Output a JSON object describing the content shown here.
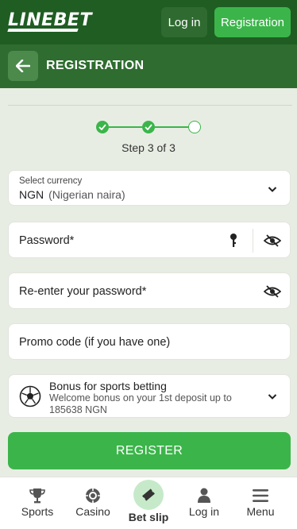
{
  "header": {
    "logo": "LINEBET",
    "login_label": "Log in",
    "registration_label": "Registration"
  },
  "titlebar": {
    "title": "REGISTRATION"
  },
  "stepper": {
    "text": "Step 3 of 3",
    "current": 3,
    "total": 3
  },
  "form": {
    "currency": {
      "label": "Select currency",
      "code": "NGN",
      "name": "(Nigerian naira)"
    },
    "password_placeholder": "Password*",
    "reenter_placeholder": "Re-enter your password*",
    "promo_placeholder": "Promo code (if you have one)",
    "bonus": {
      "title": "Bonus for sports betting",
      "description": "Welcome bonus on your 1st deposit up to 185638 NGN"
    },
    "register_label": "REGISTER"
  },
  "bottom_nav": {
    "items": [
      {
        "label": "Sports",
        "icon": "trophy-icon"
      },
      {
        "label": "Casino",
        "icon": "casino-chip-icon"
      },
      {
        "label": "Bet slip",
        "icon": "ticket-icon"
      },
      {
        "label": "Log in",
        "icon": "user-icon"
      },
      {
        "label": "Menu",
        "icon": "hamburger-icon"
      }
    ]
  },
  "colors": {
    "header_bg": "#1f5d23",
    "title_bg": "#2e6d2f",
    "accent": "#3bb54a",
    "page_bg": "#e8ede3"
  }
}
